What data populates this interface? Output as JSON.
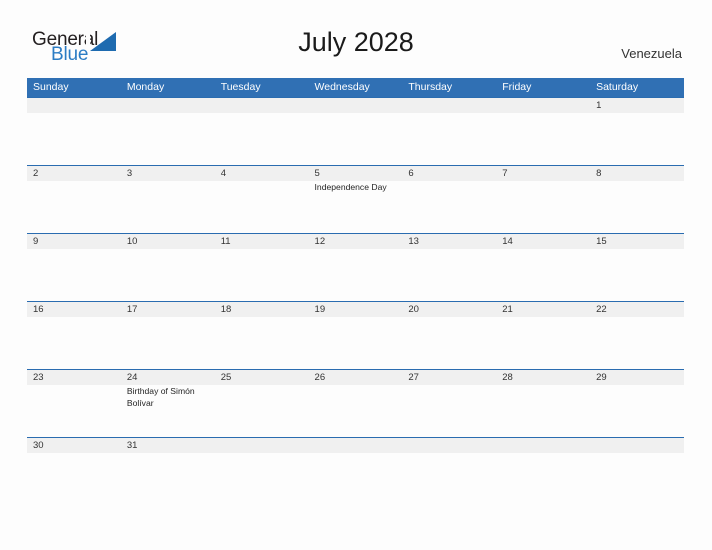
{
  "brand": {
    "name_part1": "General",
    "name_part2": "Blue"
  },
  "header": {
    "title": "July 2028",
    "country": "Venezuela"
  },
  "colors": {
    "header_blue": "#3070b4",
    "row_rule_blue": "#2a6cb0",
    "daynum_band_gray": "#f0f0f0",
    "logo_blue": "#2b7cc4",
    "page_background": "#fdfdfd"
  },
  "calendar": {
    "weekdays": [
      "Sunday",
      "Monday",
      "Tuesday",
      "Wednesday",
      "Thursday",
      "Friday",
      "Saturday"
    ],
    "weeks": [
      {
        "days": [
          {
            "num": "",
            "event": ""
          },
          {
            "num": "",
            "event": ""
          },
          {
            "num": "",
            "event": ""
          },
          {
            "num": "",
            "event": ""
          },
          {
            "num": "",
            "event": ""
          },
          {
            "num": "",
            "event": ""
          },
          {
            "num": "1",
            "event": ""
          }
        ]
      },
      {
        "days": [
          {
            "num": "2",
            "event": ""
          },
          {
            "num": "3",
            "event": ""
          },
          {
            "num": "4",
            "event": ""
          },
          {
            "num": "5",
            "event": "Independence Day"
          },
          {
            "num": "6",
            "event": ""
          },
          {
            "num": "7",
            "event": ""
          },
          {
            "num": "8",
            "event": ""
          }
        ]
      },
      {
        "days": [
          {
            "num": "9",
            "event": ""
          },
          {
            "num": "10",
            "event": ""
          },
          {
            "num": "11",
            "event": ""
          },
          {
            "num": "12",
            "event": ""
          },
          {
            "num": "13",
            "event": ""
          },
          {
            "num": "14",
            "event": ""
          },
          {
            "num": "15",
            "event": ""
          }
        ]
      },
      {
        "days": [
          {
            "num": "16",
            "event": ""
          },
          {
            "num": "17",
            "event": ""
          },
          {
            "num": "18",
            "event": ""
          },
          {
            "num": "19",
            "event": ""
          },
          {
            "num": "20",
            "event": ""
          },
          {
            "num": "21",
            "event": ""
          },
          {
            "num": "22",
            "event": ""
          }
        ]
      },
      {
        "days": [
          {
            "num": "23",
            "event": ""
          },
          {
            "num": "24",
            "event": "Birthday of Simón Bolívar"
          },
          {
            "num": "25",
            "event": ""
          },
          {
            "num": "26",
            "event": ""
          },
          {
            "num": "27",
            "event": ""
          },
          {
            "num": "28",
            "event": ""
          },
          {
            "num": "29",
            "event": ""
          }
        ]
      },
      {
        "days": [
          {
            "num": "30",
            "event": ""
          },
          {
            "num": "31",
            "event": ""
          },
          {
            "num": "",
            "event": ""
          },
          {
            "num": "",
            "event": ""
          },
          {
            "num": "",
            "event": ""
          },
          {
            "num": "",
            "event": ""
          },
          {
            "num": "",
            "event": ""
          }
        ]
      }
    ]
  }
}
